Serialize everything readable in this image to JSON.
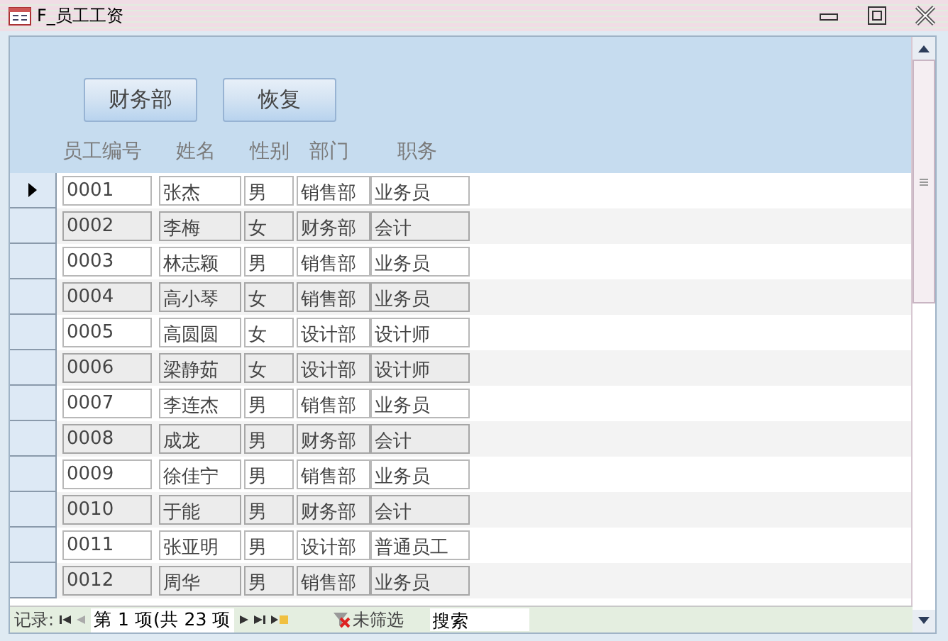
{
  "window": {
    "title": "F_员工工资"
  },
  "buttons": [
    "财务部",
    "恢复"
  ],
  "columns": [
    "员工编号",
    "姓名",
    "性别",
    "部门",
    "职务"
  ],
  "rows": [
    {
      "current": true,
      "cells": [
        "0001",
        "张杰",
        "男",
        "销售部",
        "业务员"
      ]
    },
    {
      "current": false,
      "cells": [
        "0002",
        "李梅",
        "女",
        "财务部",
        "会计"
      ]
    },
    {
      "current": false,
      "cells": [
        "0003",
        "林志颖",
        "男",
        "销售部",
        "业务员"
      ]
    },
    {
      "current": false,
      "cells": [
        "0004",
        "高小琴",
        "女",
        "销售部",
        "业务员"
      ]
    },
    {
      "current": false,
      "cells": [
        "0005",
        "高圆圆",
        "女",
        "设计部",
        "设计师"
      ]
    },
    {
      "current": false,
      "cells": [
        "0006",
        "梁静茹",
        "女",
        "设计部",
        "设计师"
      ]
    },
    {
      "current": false,
      "cells": [
        "0007",
        "李连杰",
        "男",
        "销售部",
        "业务员"
      ]
    },
    {
      "current": false,
      "cells": [
        "0008",
        "成龙",
        "男",
        "财务部",
        "会计"
      ]
    },
    {
      "current": false,
      "cells": [
        "0009",
        "徐佳宁",
        "男",
        "销售部",
        "业务员"
      ]
    },
    {
      "current": false,
      "cells": [
        "0010",
        "于能",
        "男",
        "财务部",
        "会计"
      ]
    },
    {
      "current": false,
      "cells": [
        "0011",
        "张亚明",
        "男",
        "设计部",
        "普通员工"
      ]
    },
    {
      "current": false,
      "cells": [
        "0012",
        "周华",
        "男",
        "销售部",
        "业务员"
      ]
    }
  ],
  "navigation": {
    "label": "记录:",
    "position": "第 1 项(共 23 项",
    "filter": "未筛选",
    "search": {
      "placeholder": "搜索"
    }
  }
}
